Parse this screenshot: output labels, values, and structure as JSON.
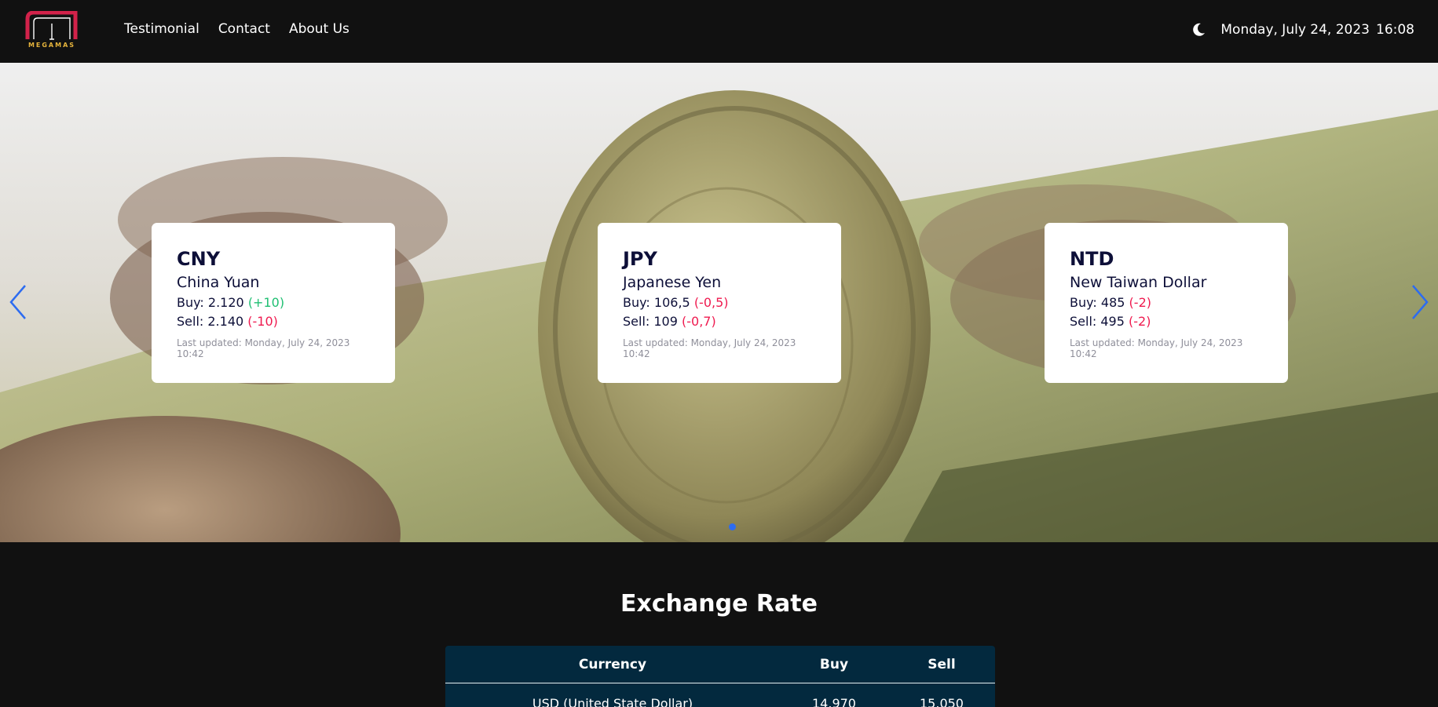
{
  "header": {
    "logo_text": "MEGAMAS",
    "nav": [
      "Testimonial",
      "Contact",
      "About Us"
    ],
    "date": "Monday, July 24, 2023",
    "time": "16:08",
    "theme_icon": "moon-icon"
  },
  "cards": [
    {
      "code": "CNY",
      "name": "China Yuan",
      "buy_label": "Buy:",
      "buy": "2.120",
      "buy_change": "(+10)",
      "buy_trend": "up",
      "sell_label": "Sell:",
      "sell": "2.140",
      "sell_change": "(-10)",
      "sell_trend": "down",
      "updated": "Last updated: Monday, July 24, 2023 10:42"
    },
    {
      "code": "JPY",
      "name": "Japanese Yen",
      "buy_label": "Buy:",
      "buy": "106,5",
      "buy_change": "(-0,5)",
      "buy_trend": "down",
      "sell_label": "Sell:",
      "sell": "109",
      "sell_change": "(-0,7)",
      "sell_trend": "down",
      "updated": "Last updated: Monday, July 24, 2023 10:42"
    },
    {
      "code": "NTD",
      "name": "New Taiwan Dollar",
      "buy_label": "Buy:",
      "buy": "485",
      "buy_change": "(-2)",
      "buy_trend": "down",
      "sell_label": "Sell:",
      "sell": "495",
      "sell_change": "(-2)",
      "sell_trend": "down",
      "updated": "Last updated: Monday, July 24, 2023 10:42"
    }
  ],
  "section": {
    "title": "Exchange Rate"
  },
  "table": {
    "headers": [
      "Currency",
      "Buy",
      "Sell"
    ],
    "rows": [
      [
        "USD (United State Dollar)",
        "14.970",
        "15.050"
      ]
    ]
  },
  "colors": {
    "positive": "#1fbf72",
    "negative": "#ef1a4f",
    "arrow": "#2d6cf0",
    "table_bg": "#03293e"
  }
}
